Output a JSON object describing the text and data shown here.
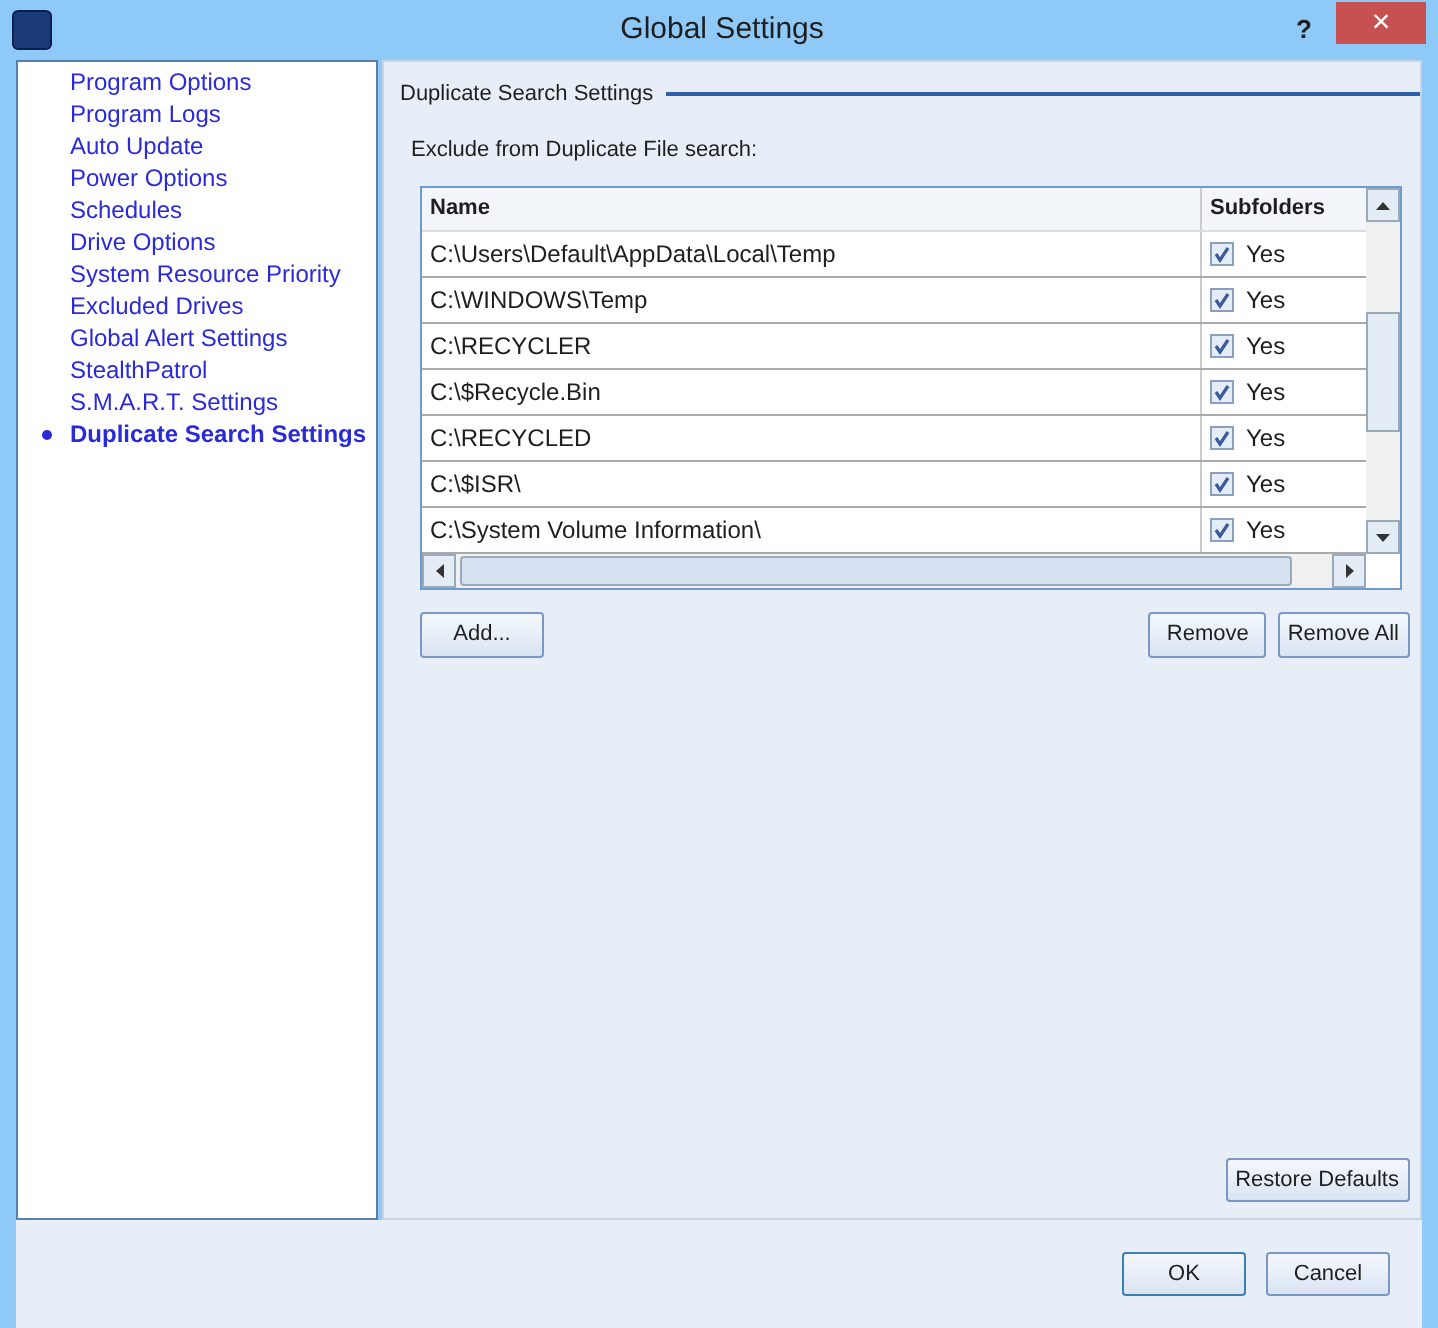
{
  "window": {
    "title": "Global Settings",
    "help": "?",
    "close": "×"
  },
  "sidebar": {
    "items": [
      {
        "label": "Program Options",
        "selected": false
      },
      {
        "label": "Program Logs",
        "selected": false
      },
      {
        "label": "Auto Update",
        "selected": false
      },
      {
        "label": "Power Options",
        "selected": false
      },
      {
        "label": "Schedules",
        "selected": false
      },
      {
        "label": "Drive Options",
        "selected": false
      },
      {
        "label": "System Resource Priority",
        "selected": false
      },
      {
        "label": "Excluded Drives",
        "selected": false
      },
      {
        "label": "Global Alert Settings",
        "selected": false
      },
      {
        "label": "StealthPatrol",
        "selected": false
      },
      {
        "label": "S.M.A.R.T. Settings",
        "selected": false
      },
      {
        "label": "Duplicate Search Settings",
        "selected": true
      }
    ]
  },
  "section": {
    "title": "Duplicate Search Settings",
    "label": "Exclude from Duplicate File search:"
  },
  "table": {
    "columns": [
      "Name",
      "Subfolders"
    ],
    "rows": [
      {
        "name": "C:\\Users\\Default\\AppData\\Local\\Temp",
        "subfolders": "Yes",
        "checked": true
      },
      {
        "name": "C:\\WINDOWS\\Temp",
        "subfolders": "Yes",
        "checked": true
      },
      {
        "name": "C:\\RECYCLER",
        "subfolders": "Yes",
        "checked": true
      },
      {
        "name": "C:\\$Recycle.Bin",
        "subfolders": "Yes",
        "checked": true
      },
      {
        "name": "C:\\RECYCLED",
        "subfolders": "Yes",
        "checked": true
      },
      {
        "name": "C:\\$ISR\\",
        "subfolders": "Yes",
        "checked": true
      },
      {
        "name": "C:\\System Volume Information\\",
        "subfolders": "Yes",
        "checked": true
      }
    ]
  },
  "buttons": {
    "add": "Add...",
    "remove": "Remove",
    "remove_all": "Remove All",
    "restore": "Restore Defaults",
    "ok": "OK",
    "cancel": "Cancel"
  }
}
